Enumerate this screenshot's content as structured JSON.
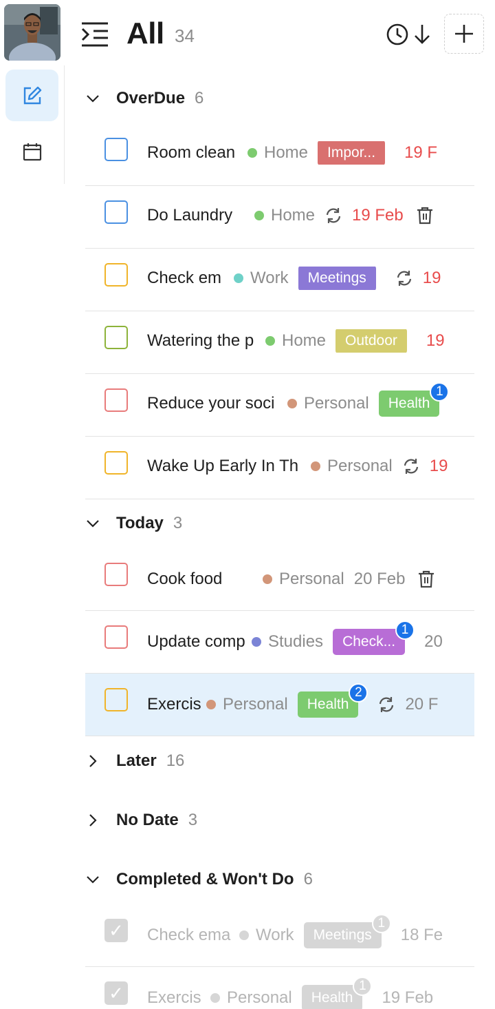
{
  "header": {
    "title": "All",
    "count": "34"
  },
  "colors": {
    "accent": "#1a73e8",
    "overdue_date": "#e84c4c",
    "selected_bg": "#e4f1fc"
  },
  "sections": [
    {
      "title": "OverDue",
      "count": "6",
      "expanded": true
    },
    {
      "title": "Today",
      "count": "3",
      "expanded": true
    },
    {
      "title": "Later",
      "count": "16",
      "expanded": false
    },
    {
      "title": "No Date",
      "count": "3",
      "expanded": false
    },
    {
      "title": "Completed & Won't Do",
      "count": "6",
      "expanded": true
    }
  ],
  "overdue": [
    {
      "title": "Room clean",
      "list": "Home",
      "list_color": "#7dcb6f",
      "tag": "Impor...",
      "tag_color": "#d9706f",
      "date": "19 F",
      "checkbox_color": "#4a90e2"
    },
    {
      "title": "Do Laundry",
      "list": "Home",
      "list_color": "#7dcb6f",
      "date": "19 Feb",
      "checkbox_color": "#4a90e2",
      "repeat": true,
      "trash": true
    },
    {
      "title": "Check em",
      "list": "Work",
      "list_color": "#6fd1c8",
      "tag": "Meetings",
      "tag_color": "#8b78d6",
      "date": "19",
      "checkbox_color": "#f0b429",
      "repeat": true
    },
    {
      "title": "Watering the p",
      "list": "Home",
      "list_color": "#7dcb6f",
      "tag": "Outdoor",
      "tag_color": "#d4cd6e",
      "date": "19",
      "checkbox_color": "#8db33a"
    },
    {
      "title": "Reduce your soci",
      "list": "Personal",
      "list_color": "#d29679",
      "tag": "Health",
      "tag_color": "#7dcb6f",
      "badge": "1",
      "checkbox_color": "#e87b7b"
    },
    {
      "title": "Wake Up Early In Th",
      "list": "Personal",
      "list_color": "#d29679",
      "date": "19",
      "checkbox_color": "#f0b429",
      "repeat": true
    }
  ],
  "today": [
    {
      "title": "Cook food",
      "list": "Personal",
      "list_color": "#d29679",
      "date": "20 Feb",
      "checkbox_color": "#e87b7b",
      "trash": true
    },
    {
      "title": "Update comp",
      "list": "Studies",
      "list_color": "#7b84d6",
      "tag": "Check...",
      "tag_color": "#b86dd6",
      "badge": "1",
      "date": "20",
      "checkbox_color": "#e87b7b"
    },
    {
      "title": "Exercis",
      "list": "Personal",
      "list_color": "#d29679",
      "tag": "Health",
      "tag_color": "#7dcb6f",
      "badge": "2",
      "date": "20 F",
      "checkbox_color": "#f0b429",
      "repeat": true
    }
  ],
  "completed": [
    {
      "title": "Check ema",
      "list": "Work",
      "tag": "Meetings",
      "badge": "1",
      "date": "18 Fe"
    },
    {
      "title": "Exercis",
      "list": "Personal",
      "tag": "Health",
      "badge": "1",
      "date": "19 Feb"
    }
  ]
}
